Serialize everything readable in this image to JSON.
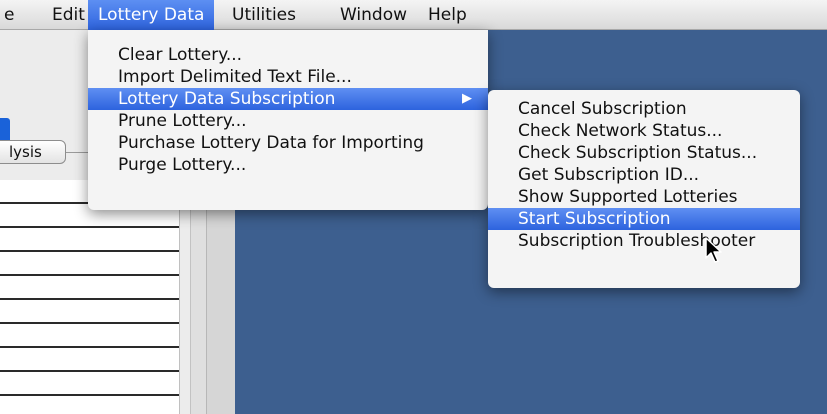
{
  "menubar": {
    "items": [
      {
        "label": "e",
        "active": false
      },
      {
        "label": "Edit",
        "active": false
      },
      {
        "label": "Lottery Data",
        "active": true
      },
      {
        "label": "Utilities",
        "active": false
      },
      {
        "label": "Window",
        "active": false
      },
      {
        "label": "Help",
        "active": false
      }
    ]
  },
  "left_window": {
    "analysis_button_label": "lysis"
  },
  "lottery_menu": {
    "items": [
      {
        "label": "Clear Lottery..."
      },
      {
        "label": "Import Delimited Text File..."
      },
      {
        "label": "Lottery Data Subscription",
        "submenu_arrow": "▶",
        "selected": true
      },
      {
        "label": "Prune Lottery..."
      },
      {
        "label": "Purchase Lottery Data for Importing"
      },
      {
        "label": "Purge Lottery..."
      }
    ]
  },
  "subscription_menu": {
    "items": [
      {
        "label": "Cancel Subscription"
      },
      {
        "label": "Check Network Status..."
      },
      {
        "label": "Check Subscription Status..."
      },
      {
        "label": "Get Subscription ID..."
      },
      {
        "label": "Show Supported Lotteries"
      },
      {
        "label": "Start Subscription",
        "selected": true
      },
      {
        "label": "Subscription Troubleshooter"
      }
    ]
  },
  "colors": {
    "desktop": "#3d5f8f",
    "selection": "#2e64df",
    "menu_bg": "#f4f4f4"
  }
}
